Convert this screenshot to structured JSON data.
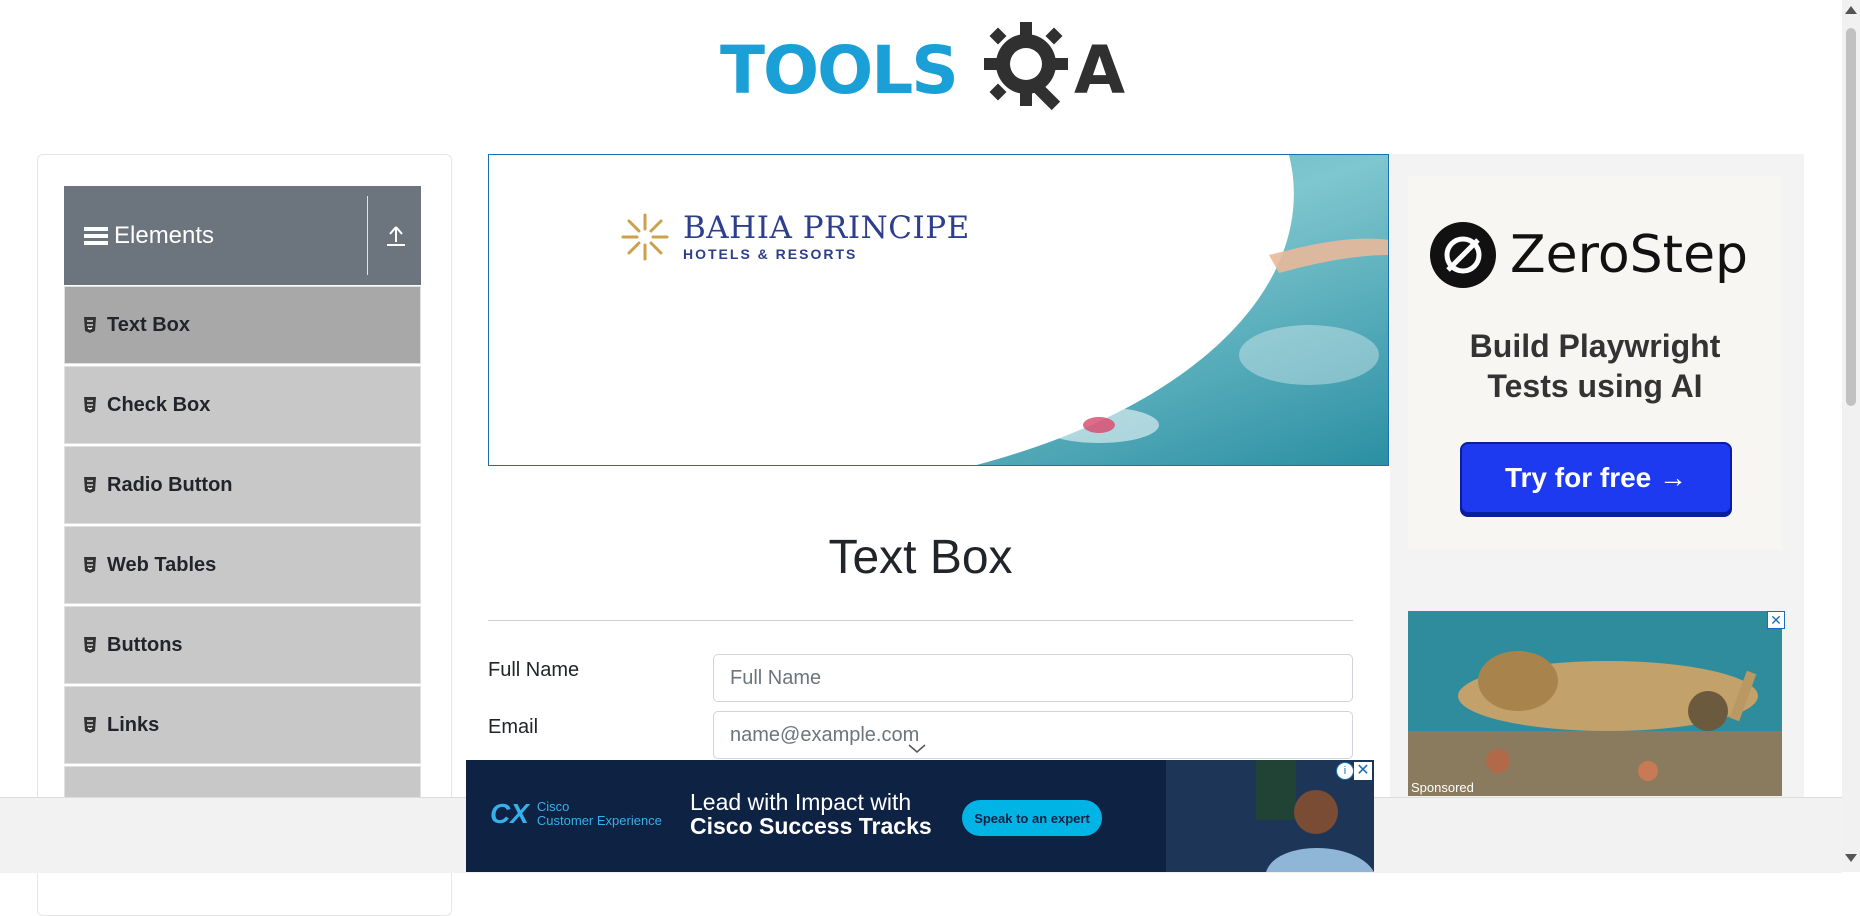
{
  "header": {
    "logo_text_primary": "TOOLS",
    "logo_text_secondary": "QA"
  },
  "sidebar": {
    "group_title": "Elements",
    "items": [
      {
        "label": "Text Box",
        "active": true
      },
      {
        "label": "Check Box",
        "active": false
      },
      {
        "label": "Radio Button",
        "active": false
      },
      {
        "label": "Web Tables",
        "active": false
      },
      {
        "label": "Buttons",
        "active": false
      },
      {
        "label": "Links",
        "active": false
      }
    ]
  },
  "banner_ad": {
    "brand_name": "BAHIA PRINCIPE",
    "brand_sub": "HOTELS & RESORTS"
  },
  "main": {
    "title": "Text Box",
    "fields": {
      "full_name": {
        "label": "Full Name",
        "placeholder": "Full Name"
      },
      "email": {
        "label": "Email",
        "placeholder": "name@example.com"
      }
    }
  },
  "right_ad": {
    "brand": "ZeroStep",
    "tagline_line1": "Build Playwright",
    "tagline_line2": "Tests using AI",
    "cta": "Try for free →",
    "second_ad_label": "Sponsored",
    "close": "✕"
  },
  "bottom_ad": {
    "logo_mark": "CX",
    "logo_line1": "Cisco",
    "logo_line2": "Customer Experience",
    "headline_line1": "Lead with Impact with",
    "headline_line2": "Cisco Success Tracks",
    "cta": "Speak to an expert",
    "info": "i",
    "close": "✕"
  },
  "colors": {
    "accent_blue": "#1a9fd6",
    "nav_header": "#6c757d",
    "cta_blue": "#1d3af0",
    "cisco_navy": "#0e2244"
  }
}
